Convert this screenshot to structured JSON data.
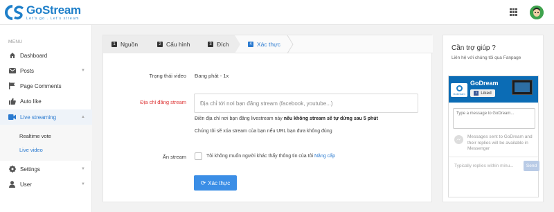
{
  "header": {
    "logo_name": "GoStream",
    "logo_tagline": "Let's go . Let's stream"
  },
  "sidebar": {
    "menu_title": "MENU",
    "items": [
      {
        "label": "Dashboard",
        "icon": "home-icon"
      },
      {
        "label": "Posts",
        "icon": "mail-icon",
        "expandable": true
      },
      {
        "label": "Page Comments",
        "icon": "flag-icon"
      },
      {
        "label": "Auto like",
        "icon": "thumb-up-icon"
      },
      {
        "label": "Live streaming",
        "icon": "video-camera-icon",
        "expandable": true,
        "active": true
      },
      {
        "label": "Settings",
        "icon": "gear-icon",
        "expandable": true
      },
      {
        "label": "User",
        "icon": "user-icon",
        "expandable": true
      }
    ],
    "subitems": [
      {
        "label": "Realtime vote"
      },
      {
        "label": "Live video",
        "active": true
      }
    ]
  },
  "steps": [
    {
      "num": "1",
      "label": "Nguồn"
    },
    {
      "num": "2",
      "label": "Cấu hình"
    },
    {
      "num": "3",
      "label": "Đích"
    },
    {
      "num": "4",
      "label": "Xác thực",
      "current": true
    }
  ],
  "form": {
    "status_label": "Trạng thái video",
    "status_value": "Đang phát - 1x",
    "address_label": "Địa chỉ đăng stream",
    "address_placeholder": "Địa chỉ tới nơi bạn đăng stream (facebook, youtube...)",
    "hint1_pre": "Điền địa chỉ nơi bạn đăng livestream này ",
    "hint1_bold": "nếu không stream sẽ tự dừng sau 5 phút",
    "hint2": "Chúng tôi sẽ xóa stream của bạn nếu URL bạn đưa không đúng",
    "hide_label": "Ẩn stream",
    "hide_text": "Tôi không muốn người khác thấy thông tin của tôi",
    "upgrade_link": "Nâng cấp",
    "verify_button": "Xác thực"
  },
  "help": {
    "title": "Cần trợ giúp ?",
    "subtitle": "Liên hệ với chúng tôi qua Fanpage",
    "page_name": "GoDream",
    "logo_text": "GoDream",
    "liked_label": "Liked",
    "message_placeholder": "Type a message to GoDream...",
    "note": "Messages sent to GoDream and their replies will be available in Messenger",
    "reply_text": "Typically replies within minu...",
    "send_label": "Send"
  },
  "colors": {
    "accent": "#2a7ad0",
    "brand": "#1e7fc9",
    "button": "#3b8ee6",
    "required_label": "#dd3333"
  }
}
